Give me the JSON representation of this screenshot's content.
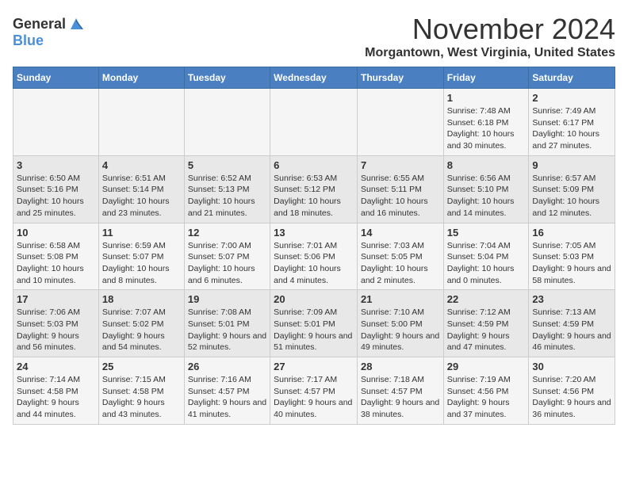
{
  "header": {
    "logo_general": "General",
    "logo_blue": "Blue",
    "month_title": "November 2024",
    "location": "Morgantown, West Virginia, United States"
  },
  "calendar": {
    "days_of_week": [
      "Sunday",
      "Monday",
      "Tuesday",
      "Wednesday",
      "Thursday",
      "Friday",
      "Saturday"
    ],
    "weeks": [
      [
        {
          "day": "",
          "sunrise": "",
          "sunset": "",
          "daylight": ""
        },
        {
          "day": "",
          "sunrise": "",
          "sunset": "",
          "daylight": ""
        },
        {
          "day": "",
          "sunrise": "",
          "sunset": "",
          "daylight": ""
        },
        {
          "day": "",
          "sunrise": "",
          "sunset": "",
          "daylight": ""
        },
        {
          "day": "",
          "sunrise": "",
          "sunset": "",
          "daylight": ""
        },
        {
          "day": "1",
          "sunrise": "Sunrise: 7:48 AM",
          "sunset": "Sunset: 6:18 PM",
          "daylight": "Daylight: 10 hours and 30 minutes."
        },
        {
          "day": "2",
          "sunrise": "Sunrise: 7:49 AM",
          "sunset": "Sunset: 6:17 PM",
          "daylight": "Daylight: 10 hours and 27 minutes."
        }
      ],
      [
        {
          "day": "3",
          "sunrise": "Sunrise: 6:50 AM",
          "sunset": "Sunset: 5:16 PM",
          "daylight": "Daylight: 10 hours and 25 minutes."
        },
        {
          "day": "4",
          "sunrise": "Sunrise: 6:51 AM",
          "sunset": "Sunset: 5:14 PM",
          "daylight": "Daylight: 10 hours and 23 minutes."
        },
        {
          "day": "5",
          "sunrise": "Sunrise: 6:52 AM",
          "sunset": "Sunset: 5:13 PM",
          "daylight": "Daylight: 10 hours and 21 minutes."
        },
        {
          "day": "6",
          "sunrise": "Sunrise: 6:53 AM",
          "sunset": "Sunset: 5:12 PM",
          "daylight": "Daylight: 10 hours and 18 minutes."
        },
        {
          "day": "7",
          "sunrise": "Sunrise: 6:55 AM",
          "sunset": "Sunset: 5:11 PM",
          "daylight": "Daylight: 10 hours and 16 minutes."
        },
        {
          "day": "8",
          "sunrise": "Sunrise: 6:56 AM",
          "sunset": "Sunset: 5:10 PM",
          "daylight": "Daylight: 10 hours and 14 minutes."
        },
        {
          "day": "9",
          "sunrise": "Sunrise: 6:57 AM",
          "sunset": "Sunset: 5:09 PM",
          "daylight": "Daylight: 10 hours and 12 minutes."
        }
      ],
      [
        {
          "day": "10",
          "sunrise": "Sunrise: 6:58 AM",
          "sunset": "Sunset: 5:08 PM",
          "daylight": "Daylight: 10 hours and 10 minutes."
        },
        {
          "day": "11",
          "sunrise": "Sunrise: 6:59 AM",
          "sunset": "Sunset: 5:07 PM",
          "daylight": "Daylight: 10 hours and 8 minutes."
        },
        {
          "day": "12",
          "sunrise": "Sunrise: 7:00 AM",
          "sunset": "Sunset: 5:07 PM",
          "daylight": "Daylight: 10 hours and 6 minutes."
        },
        {
          "day": "13",
          "sunrise": "Sunrise: 7:01 AM",
          "sunset": "Sunset: 5:06 PM",
          "daylight": "Daylight: 10 hours and 4 minutes."
        },
        {
          "day": "14",
          "sunrise": "Sunrise: 7:03 AM",
          "sunset": "Sunset: 5:05 PM",
          "daylight": "Daylight: 10 hours and 2 minutes."
        },
        {
          "day": "15",
          "sunrise": "Sunrise: 7:04 AM",
          "sunset": "Sunset: 5:04 PM",
          "daylight": "Daylight: 10 hours and 0 minutes."
        },
        {
          "day": "16",
          "sunrise": "Sunrise: 7:05 AM",
          "sunset": "Sunset: 5:03 PM",
          "daylight": "Daylight: 9 hours and 58 minutes."
        }
      ],
      [
        {
          "day": "17",
          "sunrise": "Sunrise: 7:06 AM",
          "sunset": "Sunset: 5:03 PM",
          "daylight": "Daylight: 9 hours and 56 minutes."
        },
        {
          "day": "18",
          "sunrise": "Sunrise: 7:07 AM",
          "sunset": "Sunset: 5:02 PM",
          "daylight": "Daylight: 9 hours and 54 minutes."
        },
        {
          "day": "19",
          "sunrise": "Sunrise: 7:08 AM",
          "sunset": "Sunset: 5:01 PM",
          "daylight": "Daylight: 9 hours and 52 minutes."
        },
        {
          "day": "20",
          "sunrise": "Sunrise: 7:09 AM",
          "sunset": "Sunset: 5:01 PM",
          "daylight": "Daylight: 9 hours and 51 minutes."
        },
        {
          "day": "21",
          "sunrise": "Sunrise: 7:10 AM",
          "sunset": "Sunset: 5:00 PM",
          "daylight": "Daylight: 9 hours and 49 minutes."
        },
        {
          "day": "22",
          "sunrise": "Sunrise: 7:12 AM",
          "sunset": "Sunset: 4:59 PM",
          "daylight": "Daylight: 9 hours and 47 minutes."
        },
        {
          "day": "23",
          "sunrise": "Sunrise: 7:13 AM",
          "sunset": "Sunset: 4:59 PM",
          "daylight": "Daylight: 9 hours and 46 minutes."
        }
      ],
      [
        {
          "day": "24",
          "sunrise": "Sunrise: 7:14 AM",
          "sunset": "Sunset: 4:58 PM",
          "daylight": "Daylight: 9 hours and 44 minutes."
        },
        {
          "day": "25",
          "sunrise": "Sunrise: 7:15 AM",
          "sunset": "Sunset: 4:58 PM",
          "daylight": "Daylight: 9 hours and 43 minutes."
        },
        {
          "day": "26",
          "sunrise": "Sunrise: 7:16 AM",
          "sunset": "Sunset: 4:57 PM",
          "daylight": "Daylight: 9 hours and 41 minutes."
        },
        {
          "day": "27",
          "sunrise": "Sunrise: 7:17 AM",
          "sunset": "Sunset: 4:57 PM",
          "daylight": "Daylight: 9 hours and 40 minutes."
        },
        {
          "day": "28",
          "sunrise": "Sunrise: 7:18 AM",
          "sunset": "Sunset: 4:57 PM",
          "daylight": "Daylight: 9 hours and 38 minutes."
        },
        {
          "day": "29",
          "sunrise": "Sunrise: 7:19 AM",
          "sunset": "Sunset: 4:56 PM",
          "daylight": "Daylight: 9 hours and 37 minutes."
        },
        {
          "day": "30",
          "sunrise": "Sunrise: 7:20 AM",
          "sunset": "Sunset: 4:56 PM",
          "daylight": "Daylight: 9 hours and 36 minutes."
        }
      ]
    ]
  }
}
